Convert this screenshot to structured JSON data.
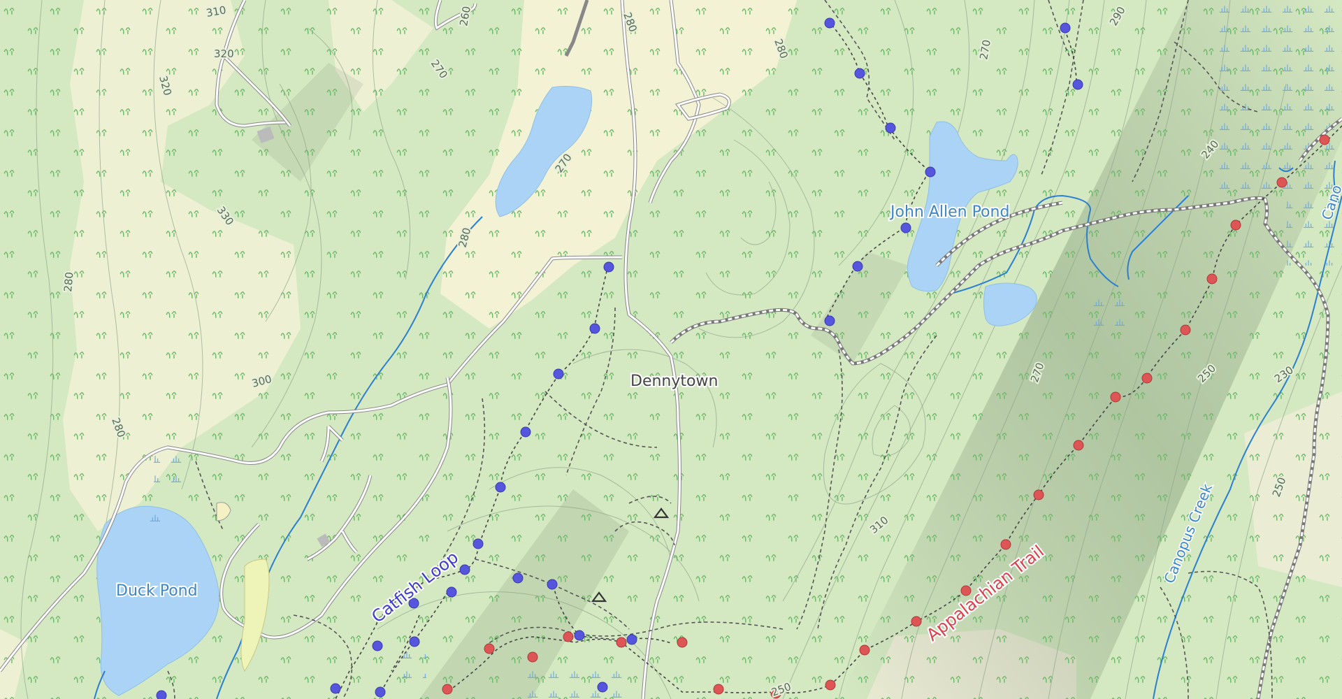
{
  "map": {
    "colors": {
      "forest": "#d4e8c2",
      "open_land": "#f4f2d4",
      "water": "#aad3f5",
      "trail_blue": "#5555dd",
      "trail_red": "#dd5555",
      "stream": "#2a7fcf"
    },
    "water_labels": {
      "duck_pond": "Duck Pond",
      "john_allen_pond": "John Allen Pond"
    },
    "place_labels": {
      "dennytown": "Dennytown"
    },
    "trail_labels": {
      "catfish_loop": "Catfish Loop",
      "appalachian_trail": "Appalachian Trail"
    },
    "creek_labels": {
      "canopus_creek": "Canopus Creek",
      "canopus_creek_edge": "Cano"
    },
    "contour_labels": [
      "310",
      "320",
      "320",
      "260",
      "280",
      "280",
      "270",
      "270",
      "330",
      "280",
      "300",
      "280",
      "280",
      "290",
      "270",
      "240",
      "270",
      "250",
      "230",
      "310",
      "250",
      "250"
    ],
    "icons": {
      "campsite_1": "campsite-icon",
      "campsite_2": "campsite-icon",
      "building": "building-icon"
    }
  }
}
